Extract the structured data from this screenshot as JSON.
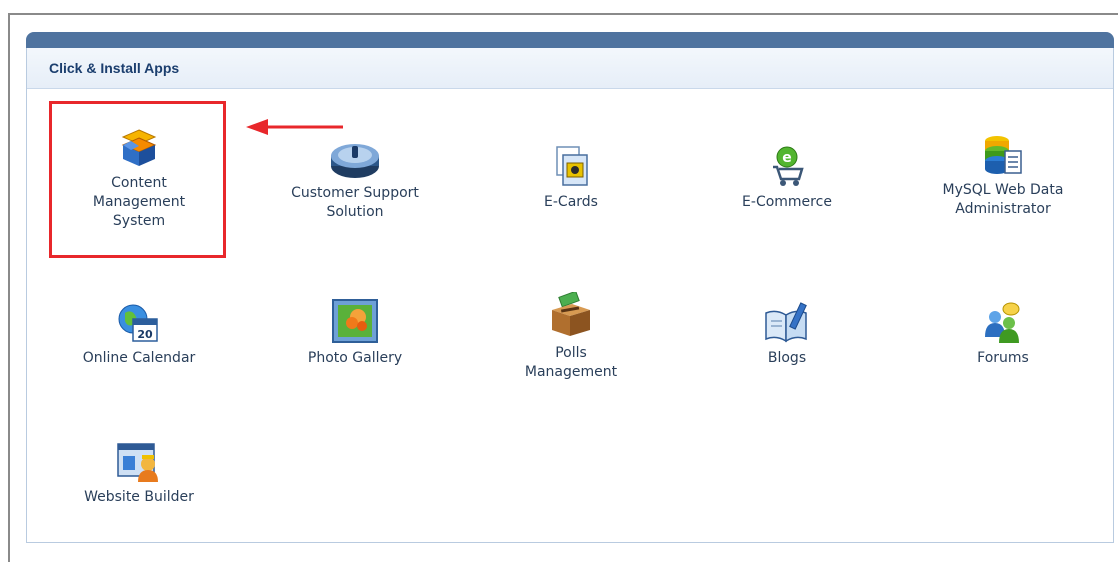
{
  "panel": {
    "title": "Click & Install Apps"
  },
  "apps": [
    {
      "label": "Content\nManagement\nSystem",
      "icon": "cms-boxes-icon"
    },
    {
      "label": "Customer Support\nSolution",
      "icon": "support-disc-icon"
    },
    {
      "label": "E-Cards",
      "icon": "ecard-icon"
    },
    {
      "label": "E-Commerce",
      "icon": "shopping-cart-icon"
    },
    {
      "label": "MySQL Web Data\nAdministrator",
      "icon": "database-icon"
    },
    {
      "label": "Online Calendar",
      "icon": "calendar-globe-icon"
    },
    {
      "label": "Photo Gallery",
      "icon": "photo-icon"
    },
    {
      "label": "Polls\nManagement",
      "icon": "ballot-box-icon"
    },
    {
      "label": "Blogs",
      "icon": "book-pen-icon"
    },
    {
      "label": "Forums",
      "icon": "users-chat-icon"
    },
    {
      "label": "Website Builder",
      "icon": "website-builder-icon"
    }
  ],
  "calendar_day": "20",
  "colors": {
    "highlight": "#e8272b",
    "header_bar": "#4f739f",
    "title_text": "#1b3e6e"
  }
}
